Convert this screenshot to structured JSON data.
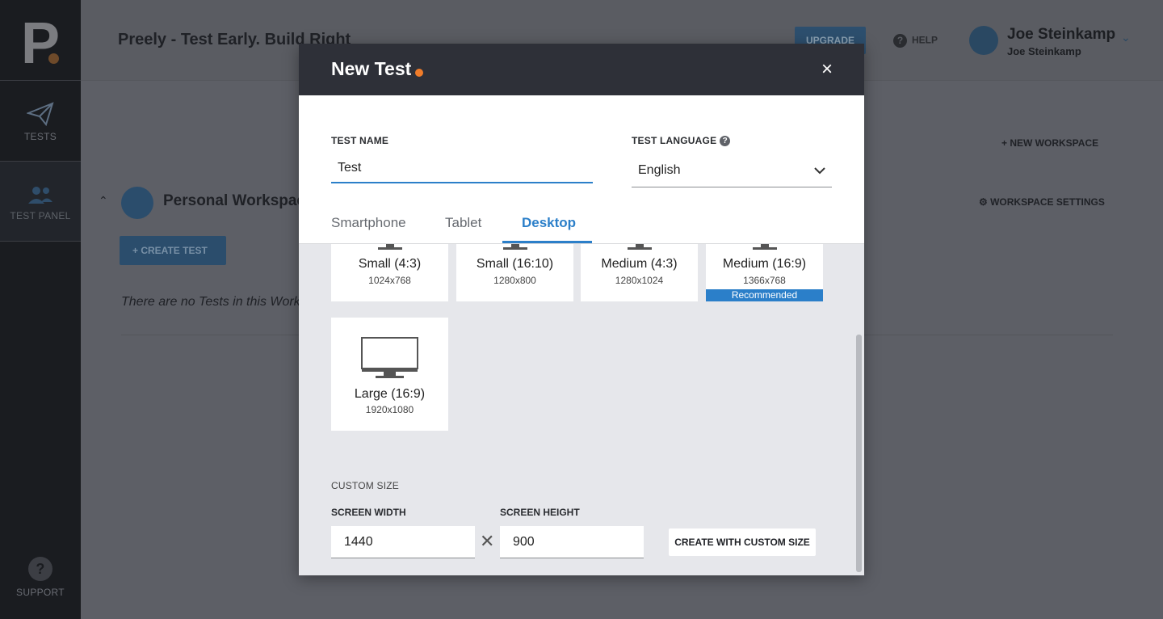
{
  "sidebar": {
    "logo_letter": "P",
    "items": [
      {
        "label": "TESTS",
        "icon": "paper-plane-icon"
      },
      {
        "label": "TEST PANEL",
        "icon": "users-icon"
      },
      {
        "label": "SUPPORT",
        "icon": "help-circle-icon"
      }
    ]
  },
  "header": {
    "title": "Preely - Test Early. Build Right",
    "upgrade_label": "UPGRADE",
    "help_label": "HELP",
    "user_name": "Joe Steinkamp",
    "user_sub": "Joe Steinkamp"
  },
  "workspace": {
    "new_workspace_label": "NEW WORKSPACE",
    "settings_label": "WORKSPACE SETTINGS",
    "name": "Personal Workspac",
    "create_test_label": "CREATE TEST",
    "empty_message": "There are no Tests in this Works"
  },
  "modal": {
    "title": "New Test",
    "close_label": "×",
    "test_name_label": "TEST NAME",
    "test_name_value": "Test",
    "test_language_label": "TEST LANGUAGE",
    "test_language_value": "English",
    "tabs": [
      {
        "label": "Smartphone",
        "active": false
      },
      {
        "label": "Tablet",
        "active": false
      },
      {
        "label": "Desktop",
        "active": true
      }
    ],
    "devices": [
      {
        "name": "Small (4:3)",
        "resolution": "1024x768"
      },
      {
        "name": "Small (16:10)",
        "resolution": "1280x800"
      },
      {
        "name": "Medium (4:3)",
        "resolution": "1280x1024"
      },
      {
        "name": "Medium (16:9)",
        "resolution": "1366x768",
        "badge": "Recommended"
      },
      {
        "name": "Large (16:9)",
        "resolution": "1920x1080"
      }
    ],
    "custom_size_label": "CUSTOM SIZE",
    "screen_width_label": "SCREEN WIDTH",
    "screen_width_value": "1440",
    "screen_height_label": "SCREEN HEIGHT",
    "screen_height_value": "900",
    "times_symbol": "✕",
    "create_custom_label": "CREATE WITH CUSTOM SIZE"
  },
  "colors": {
    "accent": "#2b7fc9",
    "brand_dot": "#f07c2a",
    "modal_header": "#2e3038",
    "overlay": "#5d5f66"
  }
}
